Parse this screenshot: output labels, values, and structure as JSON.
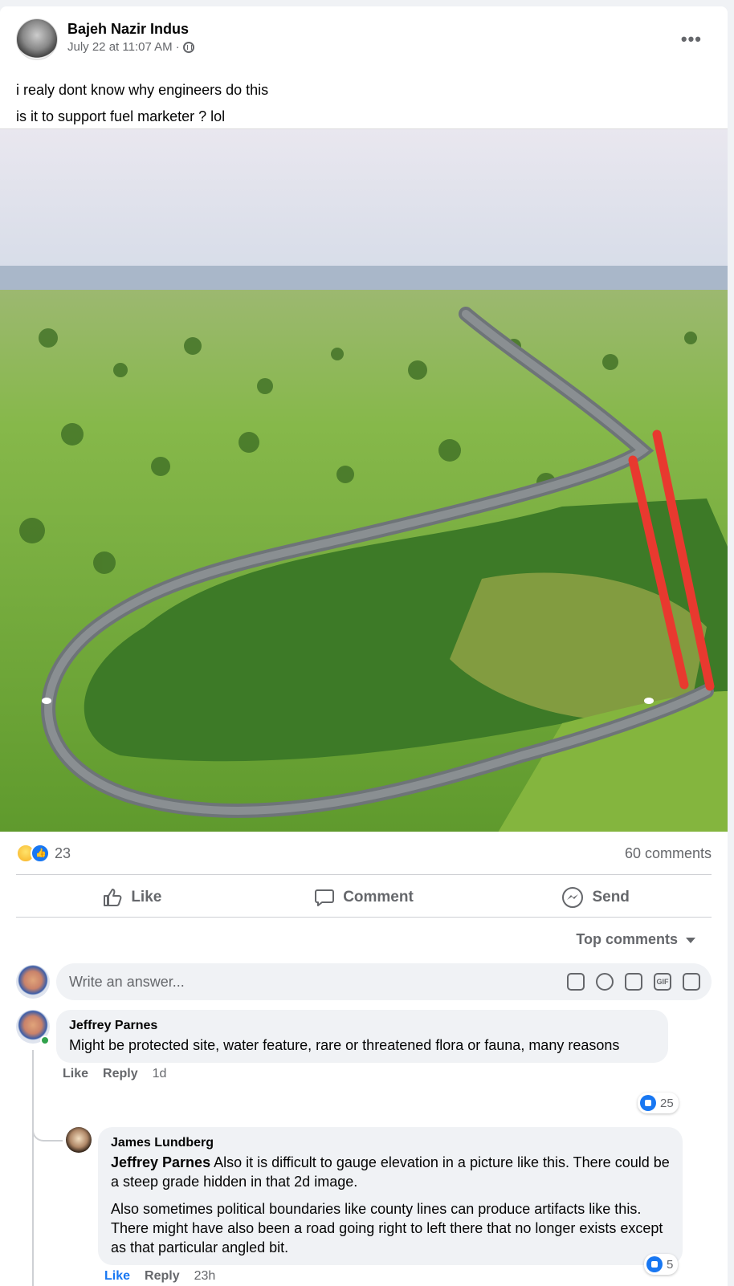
{
  "post": {
    "author": "Bajeh Nazir Indus",
    "timestamp": "July 22 at 11:07 AM",
    "privacy_separator": "·",
    "privacy_icon": "globe-icon",
    "more_label": "•••",
    "text_line1": "i realy dont know why engineers do this",
    "text_line2": "is it to support fuel marketer ? lol"
  },
  "reactions": {
    "count": "23",
    "types": [
      "haha",
      "like"
    ],
    "comments_label": "60 comments"
  },
  "actions": {
    "like": "Like",
    "comment": "Comment",
    "send": "Send"
  },
  "comments_filter": "Top comments",
  "composer": {
    "placeholder": "Write an answer...",
    "tools": [
      "avatar-sticker-icon",
      "emoji-icon",
      "camera-icon",
      "gif-icon",
      "sticker-icon"
    ],
    "gif_label": "GIF"
  },
  "comments": [
    {
      "author": "Jeffrey Parnes",
      "text": "Might be protected site, water feature, rare or threatened flora or fauna, many reasons",
      "like_label": "Like",
      "reply_label": "Reply",
      "time": "1d",
      "likes": "25"
    },
    {
      "author": "James Lundberg",
      "mention": "Jeffrey Parnes",
      "text1": " Also it is difficult to gauge elevation in a picture like this. There could be a steep grade hidden in that 2d image.",
      "text2": "Also sometimes political boundaries like county lines can produce artifacts like this. There might have also been a road going right to left there that no longer exists except as that particular angled bit.",
      "like_label": "Like",
      "reply_label": "Reply",
      "time": "23h",
      "likes": "5"
    }
  ],
  "colors": {
    "brand_blue": "#1877f2",
    "secondary_text": "#65676b",
    "bubble_bg": "#f0f2f5",
    "annotation_red": "#e8392f",
    "grass": "#7fb83a"
  }
}
